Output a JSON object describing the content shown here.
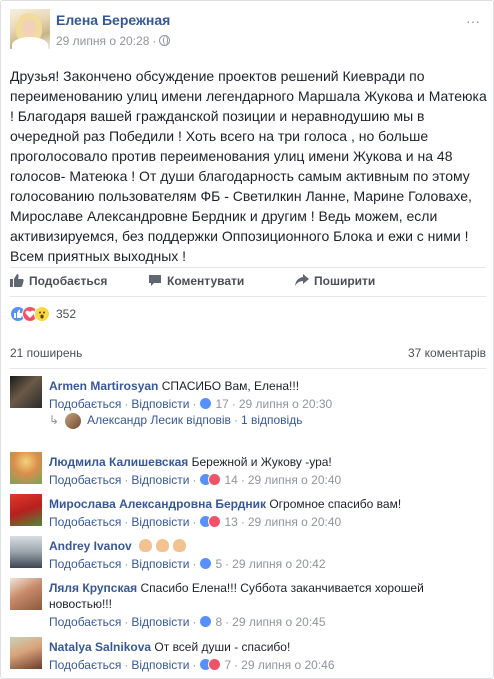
{
  "post": {
    "author": "Елена Бережная",
    "timestamp": "29 липня о 20:28",
    "dot": "·",
    "menu": "···",
    "text": "Друзья! Закончено обсуждение проектов решений Киевради по переименованию улиц имени легендарного Маршала Жукова и Матеюка ! Благодаря вашей гражданской позиции и неравнодушию мы в очередной раз Победили ! Хоть всего на три голоса , но больше проголосовало против переименования улиц имени Жукова и на 48 голосов- Матеюка ! От души благодарность самым активным по этому голосованию пользователям ФБ - Светилкин Ланне, Марине Головахе, Мирославе Александровне Бердник и другим ! Ведь можем, если активизируемся, без поддержки Оппозиционного Блока и ежи с ними ! Всем приятных выходных !"
  },
  "actions": {
    "like": "Подобається",
    "comment": "Коментувати",
    "share": "Поширити"
  },
  "reactions": {
    "count": "352",
    "types": [
      "like",
      "love",
      "wow"
    ]
  },
  "stats": {
    "shares": "21 поширень",
    "comments": "37 коментарів"
  },
  "comment_ui": {
    "like_label": "Подобається",
    "reply_label": "Відповісти",
    "dot": "·"
  },
  "comments": [
    {
      "author": "Armen Martirosyan",
      "text": "СПАСИБО Вам, Елена!!!",
      "reaction_count": "17",
      "time": "29 липня о 20:30",
      "reply": {
        "author": "Александр Лесик",
        "verb": "відповів",
        "count_text": "1 відповідь"
      }
    },
    {
      "author": "Людмила Калишевская",
      "text": "Бережной и Жукову -ура!",
      "reaction_count": "14",
      "time": "29 липня о 20:40"
    },
    {
      "author": "Мирослава Александровна Бердник",
      "text": "Огромное спасибо вам!",
      "reaction_count": "13",
      "time": "29 липня о 20:40"
    },
    {
      "author": "Andrey Ivanov",
      "text": "",
      "reaction_count": "5",
      "time": "29 липня о 20:42"
    },
    {
      "author": "Ляля Крупская",
      "text": "Спасибо Елена!!! Суббота заканчивается хорошей новостью!!!",
      "reaction_count": "8",
      "time": "29 липня о 20:45"
    },
    {
      "author": "Natalya Salnikova",
      "text": "От всей души - спасибо!",
      "reaction_count": "7",
      "time": "29 липня о 20:46"
    }
  ],
  "colors": {
    "link": "#365899",
    "meta": "#90949c",
    "like_blue": "#5890ff",
    "love_red": "#f25268",
    "wow_yellow": "#fcd93f"
  }
}
